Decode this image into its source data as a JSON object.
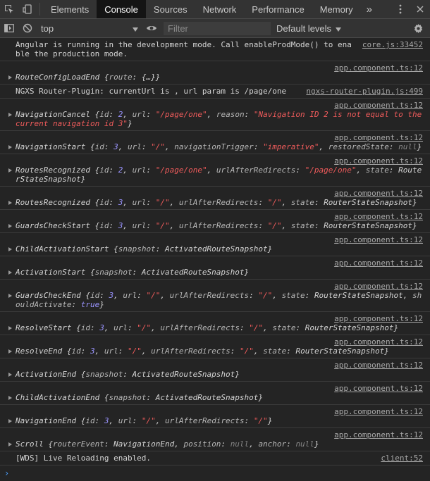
{
  "tabs": {
    "items": [
      "Elements",
      "Console",
      "Sources",
      "Network",
      "Performance",
      "Memory"
    ],
    "more": "»"
  },
  "toolbar": {
    "context": "top",
    "filter_placeholder": "Filter",
    "levels": "Default levels"
  },
  "messages": [
    {
      "text": "Angular is running in the development mode. Call enableProdMode() to enable the production mode.",
      "src": "core.js:33452"
    },
    {
      "src": "app.component.ts:12",
      "name": "RouteConfigLoadEnd",
      "body": [
        {
          "t": "k",
          "v": "route"
        },
        {
          "t": "p",
          "v": ": "
        },
        {
          "t": "obj",
          "v": "{…}"
        }
      ]
    },
    {
      "text": "NGXS Router-Plugin: currentUrl is , url param is /page/one",
      "src": "ngxs-router-plugin.js:499"
    },
    {
      "src": "app.component.ts:12",
      "name": "NavigationCancel",
      "body": [
        {
          "t": "k",
          "v": "id"
        },
        {
          "t": "p",
          "v": ": "
        },
        {
          "t": "num",
          "v": "2"
        },
        {
          "t": "p",
          "v": ", "
        },
        {
          "t": "k",
          "v": "url"
        },
        {
          "t": "p",
          "v": ": "
        },
        {
          "t": "str",
          "v": "\"/page/one\""
        },
        {
          "t": "p",
          "v": ", "
        },
        {
          "t": "k",
          "v": "reason"
        },
        {
          "t": "p",
          "v": ": "
        },
        {
          "t": "str",
          "v": "\"Navigation ID 2 is not equal to the current navigation id 3\""
        }
      ]
    },
    {
      "src": "app.component.ts:12",
      "name": "NavigationStart",
      "body": [
        {
          "t": "k",
          "v": "id"
        },
        {
          "t": "p",
          "v": ": "
        },
        {
          "t": "num",
          "v": "3"
        },
        {
          "t": "p",
          "v": ", "
        },
        {
          "t": "k",
          "v": "url"
        },
        {
          "t": "p",
          "v": ": "
        },
        {
          "t": "str",
          "v": "\"/\""
        },
        {
          "t": "p",
          "v": ", "
        },
        {
          "t": "k",
          "v": "navigationTrigger"
        },
        {
          "t": "p",
          "v": ": "
        },
        {
          "t": "str",
          "v": "\"imperative\""
        },
        {
          "t": "p",
          "v": ", "
        },
        {
          "t": "k",
          "v": "restoredState"
        },
        {
          "t": "p",
          "v": ": "
        },
        {
          "t": "nul",
          "v": "null"
        }
      ]
    },
    {
      "src": "app.component.ts:12",
      "name": "RoutesRecognized",
      "body": [
        {
          "t": "k",
          "v": "id"
        },
        {
          "t": "p",
          "v": ": "
        },
        {
          "t": "num",
          "v": "2"
        },
        {
          "t": "p",
          "v": ", "
        },
        {
          "t": "k",
          "v": "url"
        },
        {
          "t": "p",
          "v": ": "
        },
        {
          "t": "str",
          "v": "\"/page/one\""
        },
        {
          "t": "p",
          "v": ", "
        },
        {
          "t": "k",
          "v": "urlAfterRedirects"
        },
        {
          "t": "p",
          "v": ": "
        },
        {
          "t": "str",
          "v": "\"/page/one\""
        },
        {
          "t": "p",
          "v": ", "
        },
        {
          "t": "k",
          "v": "state"
        },
        {
          "t": "p",
          "v": ": "
        },
        {
          "t": "obj",
          "v": "RouterStateSnapshot"
        }
      ]
    },
    {
      "src": "app.component.ts:12",
      "name": "RoutesRecognized",
      "body": [
        {
          "t": "k",
          "v": "id"
        },
        {
          "t": "p",
          "v": ": "
        },
        {
          "t": "num",
          "v": "3"
        },
        {
          "t": "p",
          "v": ", "
        },
        {
          "t": "k",
          "v": "url"
        },
        {
          "t": "p",
          "v": ": "
        },
        {
          "t": "str",
          "v": "\"/\""
        },
        {
          "t": "p",
          "v": ", "
        },
        {
          "t": "k",
          "v": "urlAfterRedirects"
        },
        {
          "t": "p",
          "v": ": "
        },
        {
          "t": "str",
          "v": "\"/\""
        },
        {
          "t": "p",
          "v": ", "
        },
        {
          "t": "k",
          "v": "state"
        },
        {
          "t": "p",
          "v": ": "
        },
        {
          "t": "obj",
          "v": "RouterStateSnapshot"
        }
      ]
    },
    {
      "src": "app.component.ts:12",
      "name": "GuardsCheckStart",
      "body": [
        {
          "t": "k",
          "v": "id"
        },
        {
          "t": "p",
          "v": ": "
        },
        {
          "t": "num",
          "v": "3"
        },
        {
          "t": "p",
          "v": ", "
        },
        {
          "t": "k",
          "v": "url"
        },
        {
          "t": "p",
          "v": ": "
        },
        {
          "t": "str",
          "v": "\"/\""
        },
        {
          "t": "p",
          "v": ", "
        },
        {
          "t": "k",
          "v": "urlAfterRedirects"
        },
        {
          "t": "p",
          "v": ": "
        },
        {
          "t": "str",
          "v": "\"/\""
        },
        {
          "t": "p",
          "v": ", "
        },
        {
          "t": "k",
          "v": "state"
        },
        {
          "t": "p",
          "v": ": "
        },
        {
          "t": "obj",
          "v": "RouterStateSnapshot"
        }
      ]
    },
    {
      "src": "app.component.ts:12",
      "name": "ChildActivationStart",
      "body": [
        {
          "t": "k",
          "v": "snapshot"
        },
        {
          "t": "p",
          "v": ": "
        },
        {
          "t": "obj",
          "v": "ActivatedRouteSnapshot"
        }
      ]
    },
    {
      "src": "app.component.ts:12",
      "name": "ActivationStart",
      "body": [
        {
          "t": "k",
          "v": "snapshot"
        },
        {
          "t": "p",
          "v": ": "
        },
        {
          "t": "obj",
          "v": "ActivatedRouteSnapshot"
        }
      ]
    },
    {
      "src": "app.component.ts:12",
      "name": "GuardsCheckEnd",
      "body": [
        {
          "t": "k",
          "v": "id"
        },
        {
          "t": "p",
          "v": ": "
        },
        {
          "t": "num",
          "v": "3"
        },
        {
          "t": "p",
          "v": ", "
        },
        {
          "t": "k",
          "v": "url"
        },
        {
          "t": "p",
          "v": ": "
        },
        {
          "t": "str",
          "v": "\"/\""
        },
        {
          "t": "p",
          "v": ", "
        },
        {
          "t": "k",
          "v": "urlAfterRedirects"
        },
        {
          "t": "p",
          "v": ": "
        },
        {
          "t": "str",
          "v": "\"/\""
        },
        {
          "t": "p",
          "v": ", "
        },
        {
          "t": "k",
          "v": "state"
        },
        {
          "t": "p",
          "v": ": "
        },
        {
          "t": "obj",
          "v": "RouterStateSnapshot"
        },
        {
          "t": "p",
          "v": ", "
        },
        {
          "t": "k",
          "v": "shouldActivate"
        },
        {
          "t": "p",
          "v": ": "
        },
        {
          "t": "bool",
          "v": "true"
        }
      ]
    },
    {
      "src": "app.component.ts:12",
      "name": "ResolveStart",
      "body": [
        {
          "t": "k",
          "v": "id"
        },
        {
          "t": "p",
          "v": ": "
        },
        {
          "t": "num",
          "v": "3"
        },
        {
          "t": "p",
          "v": ", "
        },
        {
          "t": "k",
          "v": "url"
        },
        {
          "t": "p",
          "v": ": "
        },
        {
          "t": "str",
          "v": "\"/\""
        },
        {
          "t": "p",
          "v": ", "
        },
        {
          "t": "k",
          "v": "urlAfterRedirects"
        },
        {
          "t": "p",
          "v": ": "
        },
        {
          "t": "str",
          "v": "\"/\""
        },
        {
          "t": "p",
          "v": ", "
        },
        {
          "t": "k",
          "v": "state"
        },
        {
          "t": "p",
          "v": ": "
        },
        {
          "t": "obj",
          "v": "RouterStateSnapshot"
        }
      ]
    },
    {
      "src": "app.component.ts:12",
      "name": "ResolveEnd",
      "body": [
        {
          "t": "k",
          "v": "id"
        },
        {
          "t": "p",
          "v": ": "
        },
        {
          "t": "num",
          "v": "3"
        },
        {
          "t": "p",
          "v": ", "
        },
        {
          "t": "k",
          "v": "url"
        },
        {
          "t": "p",
          "v": ": "
        },
        {
          "t": "str",
          "v": "\"/\""
        },
        {
          "t": "p",
          "v": ", "
        },
        {
          "t": "k",
          "v": "urlAfterRedirects"
        },
        {
          "t": "p",
          "v": ": "
        },
        {
          "t": "str",
          "v": "\"/\""
        },
        {
          "t": "p",
          "v": ", "
        },
        {
          "t": "k",
          "v": "state"
        },
        {
          "t": "p",
          "v": ": "
        },
        {
          "t": "obj",
          "v": "RouterStateSnapshot"
        }
      ]
    },
    {
      "src": "app.component.ts:12",
      "name": "ActivationEnd",
      "body": [
        {
          "t": "k",
          "v": "snapshot"
        },
        {
          "t": "p",
          "v": ": "
        },
        {
          "t": "obj",
          "v": "ActivatedRouteSnapshot"
        }
      ]
    },
    {
      "src": "app.component.ts:12",
      "name": "ChildActivationEnd",
      "body": [
        {
          "t": "k",
          "v": "snapshot"
        },
        {
          "t": "p",
          "v": ": "
        },
        {
          "t": "obj",
          "v": "ActivatedRouteSnapshot"
        }
      ]
    },
    {
      "src": "app.component.ts:12",
      "name": "NavigationEnd",
      "body": [
        {
          "t": "k",
          "v": "id"
        },
        {
          "t": "p",
          "v": ": "
        },
        {
          "t": "num",
          "v": "3"
        },
        {
          "t": "p",
          "v": ", "
        },
        {
          "t": "k",
          "v": "url"
        },
        {
          "t": "p",
          "v": ": "
        },
        {
          "t": "str",
          "v": "\"/\""
        },
        {
          "t": "p",
          "v": ", "
        },
        {
          "t": "k",
          "v": "urlAfterRedirects"
        },
        {
          "t": "p",
          "v": ": "
        },
        {
          "t": "str",
          "v": "\"/\""
        }
      ]
    },
    {
      "src": "app.component.ts:12",
      "name": "Scroll",
      "body": [
        {
          "t": "k",
          "v": "routerEvent"
        },
        {
          "t": "p",
          "v": ": "
        },
        {
          "t": "obj",
          "v": "NavigationEnd"
        },
        {
          "t": "p",
          "v": ", "
        },
        {
          "t": "k",
          "v": "position"
        },
        {
          "t": "p",
          "v": ": "
        },
        {
          "t": "nul",
          "v": "null"
        },
        {
          "t": "p",
          "v": ", "
        },
        {
          "t": "k",
          "v": "anchor"
        },
        {
          "t": "p",
          "v": ": "
        },
        {
          "t": "nul",
          "v": "null"
        }
      ]
    },
    {
      "text": "[WDS] Live Reloading enabled.",
      "src": "client:52"
    }
  ],
  "prompt": "›"
}
